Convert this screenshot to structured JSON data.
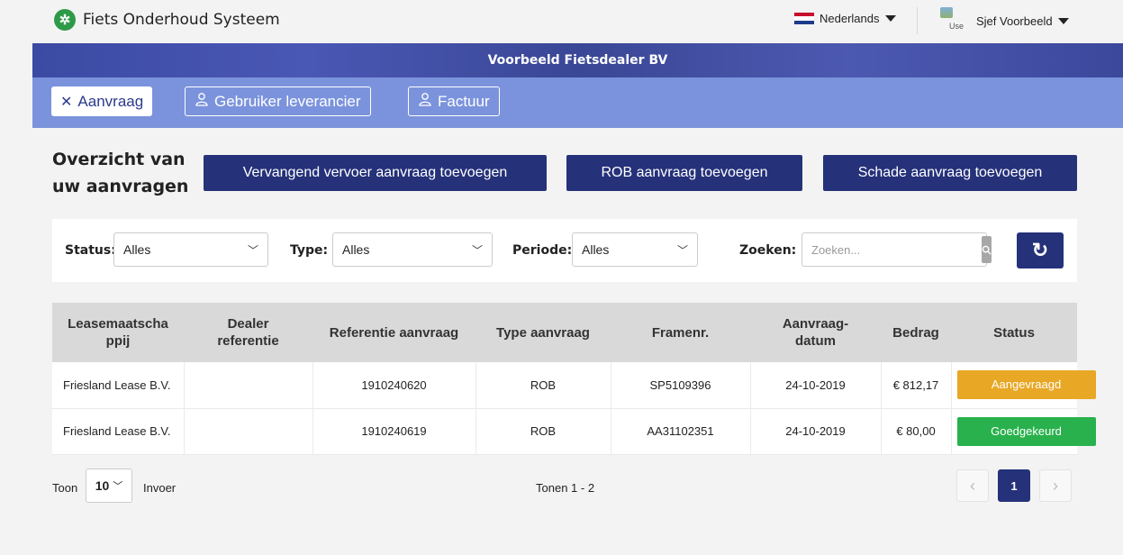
{
  "header": {
    "app_title": "Fiets Onderhoud Systeem",
    "language": "Nederlands",
    "user_name": "Sjef Voorbeeld",
    "avatar_alt": "Use"
  },
  "banner": {
    "dealer_name": "Voorbeeld Fietsdealer BV"
  },
  "nav": {
    "tabs": [
      {
        "label": "Aanvraag",
        "icon": "tools-icon",
        "active": true
      },
      {
        "label": "Gebruiker leverancier",
        "icon": "user-icon",
        "active": false
      },
      {
        "label": "Factuur",
        "icon": "user-icon",
        "active": false
      }
    ]
  },
  "main": {
    "title": "Overzicht van uw aanvragen",
    "buttons": {
      "vervangend": "Vervangend vervoer aanvraag toevoegen",
      "rob": "ROB aanvraag toevoegen",
      "schade": "Schade aanvraag toevoegen"
    }
  },
  "filters": {
    "status_label": "Status:",
    "status_value": "Alles",
    "type_label": "Type:",
    "type_value": "Alles",
    "periode_label": "Periode:",
    "periode_value": "Alles",
    "zoeken_label": "Zoeken:",
    "zoeken_placeholder": "Zoeken..."
  },
  "table": {
    "columns": [
      "Leasemaatschappij",
      "Dealer referentie",
      "Referentie aanvraag",
      "Type aanvraag",
      "Framenr.",
      "Aanvraag-datum",
      "Bedrag",
      "Status"
    ],
    "rows": [
      {
        "lease": "Friesland Lease B.V.",
        "dealer_ref": "",
        "referentie": "1910240620",
        "type": "ROB",
        "framenr": "SP5109396",
        "datum": "24-10-2019",
        "bedrag": "€ 812,17",
        "status": "Aangevraagd",
        "status_color": "#e8a724"
      },
      {
        "lease": "Friesland Lease B.V.",
        "dealer_ref": "",
        "referentie": "1910240619",
        "type": "ROB",
        "framenr": "AA31102351",
        "datum": "24-10-2019",
        "bedrag": "€ 80,00",
        "status": "Goedgekeurd",
        "status_color": "#28b14c"
      }
    ]
  },
  "footer": {
    "toon_label": "Toon",
    "entries_value": "10",
    "invoer_label": "Invoer",
    "range_text": "Tonen 1 - 2",
    "current_page": "1"
  },
  "colors": {
    "primary": "#253179",
    "nav_bg": "#7b93dc",
    "logo": "#2e9a48"
  }
}
